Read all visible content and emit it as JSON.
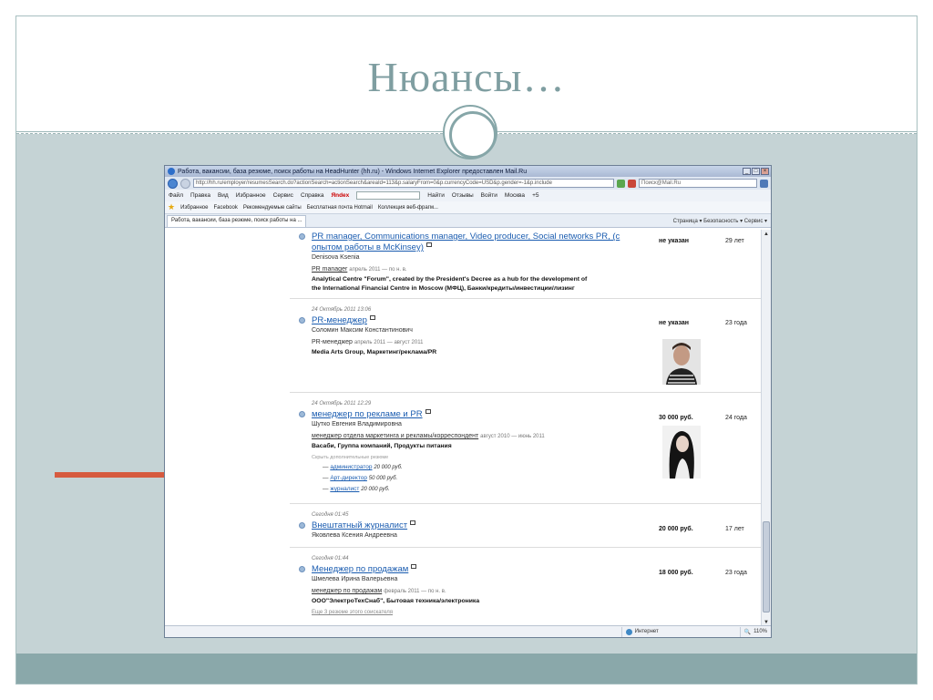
{
  "slide": {
    "title": "Нюансы…",
    "colors": {
      "title": "#7f9ea1",
      "band": "#c5d3d5",
      "bottom": "#8aa8aa",
      "arrow": "#d65a3f"
    }
  },
  "browser": {
    "window_title": "Работа, вакансии, база резюме, поиск работы на HeadHunter (hh.ru) - Windows Internet Explorer предоставлен Mail.Ru",
    "url": "http://hh.ru/employer/resumesSearch.do?actionSearch=actionSearch&areaId=113&p.salaryFrom=0&p.currencyCode=USD&p.gender=-1&p.include",
    "search_placeholder": "Поиск@Mail.Ru",
    "menu": [
      "Файл",
      "Правка",
      "Вид",
      "Избранное",
      "Сервис",
      "Справка"
    ],
    "yandex_label": "Яndex",
    "find_label": "Найти",
    "reviews_label": "Отзывы",
    "login_label": "Войти",
    "city_label": "Москва",
    "temp_label": "+5",
    "favorites": [
      "Избранное",
      "Facebook",
      "Рекомендуемые сайты",
      "Бесплатная почта Hotmail",
      "Коллекция веб-фрагм..."
    ],
    "tab_label": "Работа, вакансии, база резюме, поиск работы на ...",
    "tab_tools": "Страница ▾  Безопасность ▾  Сервис ▾",
    "status_zone": "Интернет",
    "zoom": "110%"
  },
  "resumes": [
    {
      "date": "",
      "title_line1": "PR manager, Communications manager, Video producer, Social networks PR, (с",
      "title_line2": "опытом работы в McKinsey)",
      "name": "Denisova Ksenia",
      "position": "PR manager",
      "period": "апрель 2011 — по н. в.",
      "company_line1": "Analytical Centre \"Forum\", created by the President's Decree as a hub for the development of",
      "company_line2": "the International Financial Centre in Moscow (МФЦ), Банки/кредиты/инвестиции/лизинг",
      "salary": "не указан",
      "age": "29 лет"
    },
    {
      "date": "24 Октябрь 2011 13:06",
      "title_line1": "PR-менеджер",
      "name": "Соломин Максим Константинович",
      "position": "PR-менеджер",
      "period": "апрель 2011 — август 2011",
      "company_line1": "Media Arts Group, Маркетинг/реклама/PR",
      "salary": "не указан",
      "age": "23 года"
    },
    {
      "date": "24 Октябрь 2011 12:29",
      "title_line1": "менеджер по рекламе и PR",
      "name": "Шутко Евгения Владимировна",
      "position": "менеджер отдела маркетинга и рекламы/корреспондент",
      "period": "август 2010 — июнь 2011",
      "company_line1": "Васаби, Группа компаний, Продукты питания",
      "hidden_label": "Скрыть дополнительные резюме",
      "extras": [
        {
          "title": "администратор",
          "salary": "20 000 руб."
        },
        {
          "title": "Арт-директор",
          "salary": "50 000 руб."
        },
        {
          "title": "журналист",
          "salary": "20 000 руб."
        }
      ],
      "salary": "30 000 руб.",
      "age": "24 года"
    },
    {
      "date": "Сегодня 01:45",
      "title_line1": "Внештатный журналист",
      "name": "Яковлева Ксения Андреевна",
      "salary": "20 000 руб.",
      "age": "17 лет"
    },
    {
      "date": "Сегодня 01:44",
      "title_line1": "Менеджер по продажам",
      "name": "Шмелева Ирина Валерьевна",
      "position": "менеджер по продажам",
      "period": "февраль 2011 — по н. в.",
      "company_line1": "ООО\"ЭлектроТехСнаб\", Бытовая техника/электроника",
      "more_label": "Еще 3 резюме этого соискателя",
      "salary": "18 000 руб.",
      "age": "23 года"
    }
  ]
}
